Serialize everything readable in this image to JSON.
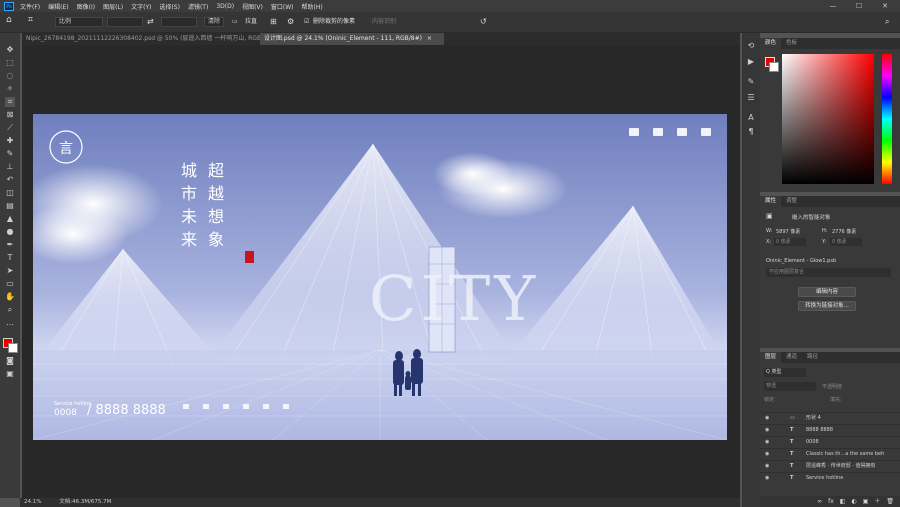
{
  "app": {
    "logo": "Ps"
  },
  "menubar": {
    "items": [
      "文件(F)",
      "编辑(E)",
      "图像(I)",
      "图层(L)",
      "文字(Y)",
      "选择(S)",
      "滤镜(T)",
      "3D(D)",
      "视图(V)",
      "窗口(W)",
      "帮助(H)"
    ],
    "window_controls": [
      "—",
      "☐",
      "✕"
    ]
  },
  "options": {
    "ratio_label": "比例",
    "clear_label": "清除",
    "straighten_label": "拉直",
    "delete_cropped_label": "删除裁剪的像素",
    "content_aware_label": "内容识别"
  },
  "tabs": [
    {
      "label": "Nipic_26784198_20211112226308402.psd @ 50% (层遥入西墙 一杆响万山, RGB/8)",
      "close": "×"
    },
    {
      "label": "设计图.psd @ 24.1% (Oninic_Element - 111, RGB/8#)",
      "close": "×",
      "active": true
    }
  ],
  "poster": {
    "logo_char": "言",
    "title_col1": [
      "城",
      "市",
      "未",
      "来"
    ],
    "title_col2": [
      "超",
      "越",
      "想",
      "象"
    ],
    "big_text": "CITY",
    "hotline_label": "Service hotline",
    "hotline_prefix": "0008",
    "hotline_number": "/ 8888 8888"
  },
  "status": {
    "zoom": "24.1%",
    "doc": "文档:46.3M/675.7M"
  },
  "color_panel": {
    "tabs": [
      "颜色",
      "色板"
    ],
    "fg_color": "#e80000",
    "bg_color": "#ffffff"
  },
  "properties": {
    "tabs": [
      "属性",
      "调整"
    ],
    "object_type": "嵌入的智能对象",
    "w_label": "W:",
    "w_value": "5897 像素",
    "h_label": "H:",
    "h_value": "2776 像素",
    "x_label": "X:",
    "x_value": "0 像素",
    "y_label": "Y:",
    "y_value": "0 像素",
    "filename": "Oninic_Element - Glow1.psb",
    "comp_placeholder": "不应用图层复合",
    "edit_button": "编辑内容",
    "convert_button": "转换为链接对象..."
  },
  "layers": {
    "tabs": [
      "图层",
      "通道",
      "路径"
    ],
    "filter_kind": "Q 类型",
    "blend_mode": "穿透",
    "opacity_label": "不透明度:",
    "lock_label": "锁定:",
    "fill_label": "填充:",
    "rows": [
      {
        "type": "▭",
        "name": "形状 4"
      },
      {
        "type": "T",
        "name": "8888 8888"
      },
      {
        "type": "T",
        "name": "0008"
      },
      {
        "type": "T",
        "name": "Classic has th...a the same beh"
      },
      {
        "type": "T",
        "name": "层遥峰秀 · 传世府邸 · 值得拥有"
      },
      {
        "type": "T",
        "name": "Service hotline"
      }
    ],
    "bottom_icons": [
      "∞",
      "fx",
      "◧",
      "◐",
      "▣",
      "＋",
      "🗑"
    ]
  }
}
